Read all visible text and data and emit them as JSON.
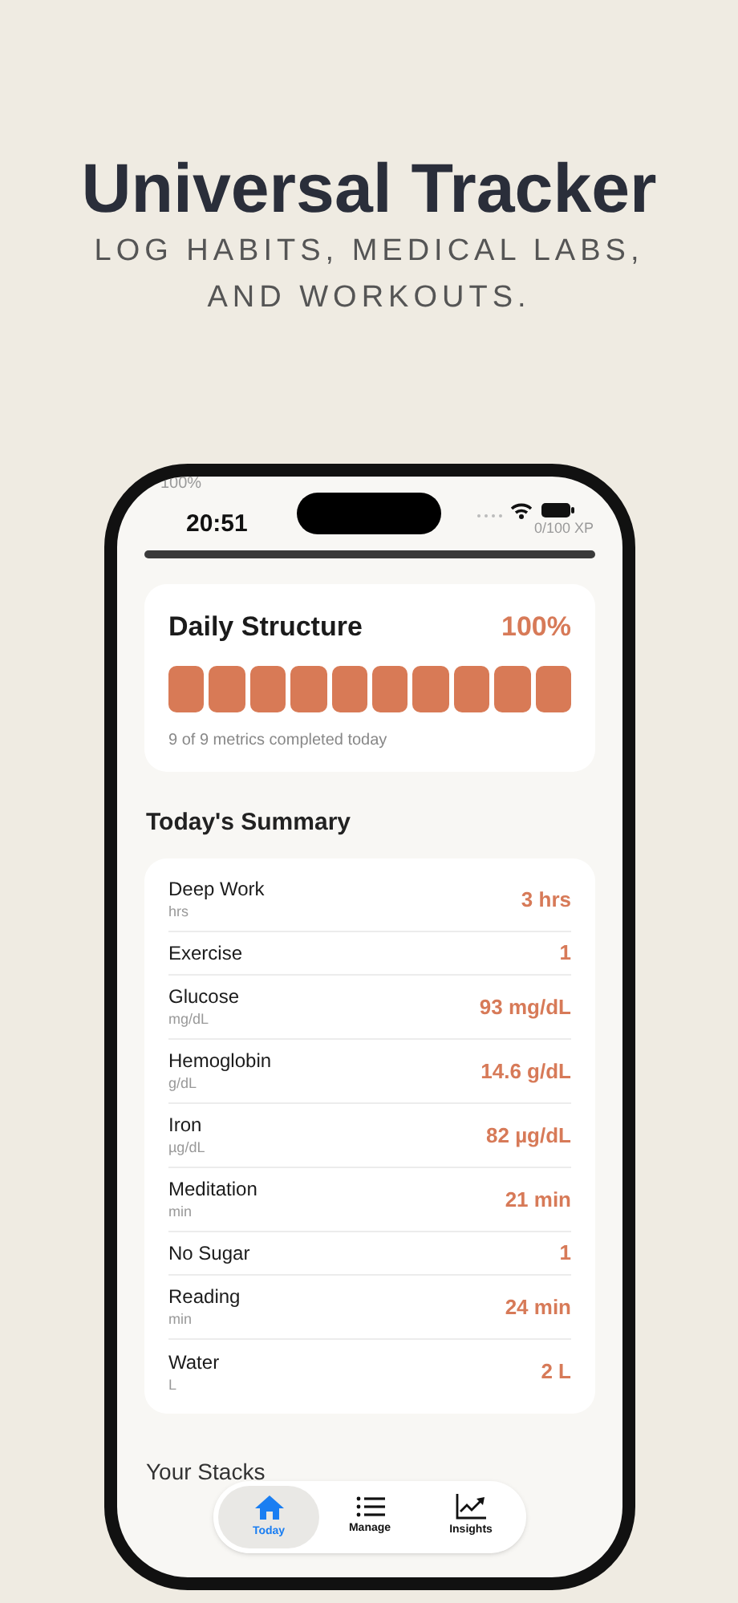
{
  "headline": {
    "title": "Universal Tracker",
    "subtitle": "LOG HABITS, MEDICAL LABS, AND WORKOUTS."
  },
  "status_bar": {
    "battery_text": "100%",
    "time": "20:51",
    "xp": "0/100 XP"
  },
  "daily_structure": {
    "title": "Daily Structure",
    "percent": "100%",
    "caption": "9 of 9 metrics completed today",
    "segments": [
      {
        "filled": true
      },
      {
        "filled": true
      },
      {
        "filled": true
      },
      {
        "filled": true
      },
      {
        "filled": true
      },
      {
        "filled": true
      },
      {
        "filled": true
      },
      {
        "filled": true
      },
      {
        "filled": true
      },
      {
        "filled": true
      }
    ]
  },
  "summary": {
    "title": "Today's Summary",
    "rows": [
      {
        "name": "Deep Work",
        "unit": "hrs",
        "value": "3 hrs"
      },
      {
        "name": "Exercise",
        "value": "1"
      },
      {
        "name": "Glucose",
        "unit": "mg/dL",
        "value": "93 mg/dL"
      },
      {
        "name": "Hemoglobin",
        "unit": "g/dL",
        "value": "14.6 g/dL"
      },
      {
        "name": "Iron",
        "unit": "µg/dL",
        "value": "82 µg/dL"
      },
      {
        "name": "Meditation",
        "unit": "min",
        "value": "21 min"
      },
      {
        "name": "No Sugar",
        "value": "1"
      },
      {
        "name": "Reading",
        "unit": "min",
        "value": "24 min"
      },
      {
        "name": "Water",
        "unit": "L",
        "value": "2 L"
      }
    ]
  },
  "stacks": {
    "title": "Your Stacks"
  },
  "tab_bar": [
    {
      "label": "Today",
      "selected": true
    },
    {
      "label": "Manage",
      "selected": false
    },
    {
      "label": "Insights",
      "selected": false
    }
  ]
}
